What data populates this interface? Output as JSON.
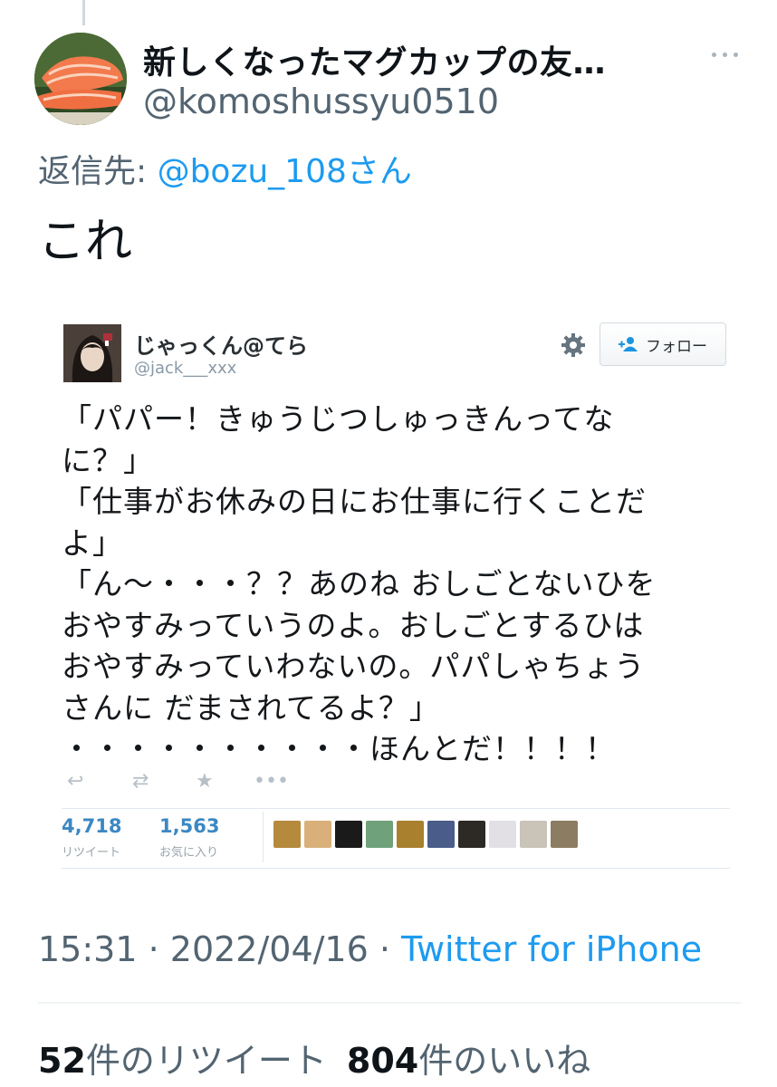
{
  "tweet": {
    "author_name": "新しくなったマグカップの友…",
    "author_handle": "@komoshussyu0510",
    "reply_label": "返信先: ",
    "reply_mention": "@bozu_108さん",
    "text": "これ",
    "time": "15:31",
    "separator": " · ",
    "date": "2022/04/16",
    "source": "Twitter for iPhone",
    "retweet_count": "52",
    "retweet_label": "件のリツイート",
    "like_count": "804",
    "like_label": "件のいいね",
    "avatar_icon": "salmon-sushi-avatar",
    "colors": {
      "link": "#1d9bf0",
      "muted": "#536471",
      "text": "#0f1419"
    }
  },
  "embedded": {
    "name": "じゃっくん@てら",
    "handle": "@jack___xxx",
    "follow_label": "フォロー",
    "lines": [
      "「パパー！きゅうじつしゅっきんってな",
      "に？」",
      "「仕事がお休みの日にお仕事に行くことだ",
      "よ」",
      "「ん～・・・？？あのね おしごとないひを",
      "おやすみっていうのよ。おしごとするひは",
      "おやすみっていわないの。パパしゃちょう",
      "さんに だまされてるよ？」",
      "・・・・・・・・・・ほんとだ！！！！"
    ],
    "actions": [
      "reply-icon",
      "retweet-icon",
      "favorite-icon",
      "more-icon"
    ],
    "retweets_value": "4,718",
    "retweets_label": "リツイート",
    "favorites_value": "1,563",
    "favorites_label": "お気に入り",
    "favoriter_colors": [
      "#b58a3c",
      "#d9b07a",
      "#1a1a1a",
      "#6fa17a",
      "#a8802e",
      "#4a5d8a",
      "#2d2a26",
      "#e2e0e4",
      "#c9c3b8",
      "#8c7d62"
    ]
  }
}
